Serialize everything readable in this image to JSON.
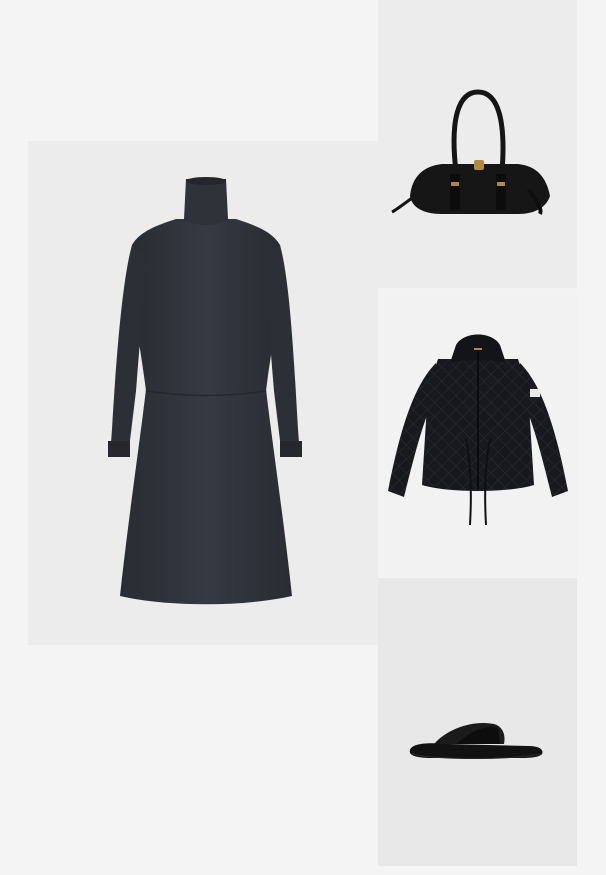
{
  "products": [
    {
      "id": "dress",
      "icon": "turtleneck-knit-dress-image",
      "color": "#2f3139"
    },
    {
      "id": "bag",
      "icon": "black-leather-shoulder-bag-image",
      "color": "#141414"
    },
    {
      "id": "jacket",
      "icon": "quilted-hooded-jacket-image",
      "color": "#16181c"
    },
    {
      "id": "sandal",
      "icon": "crossover-flat-sandal-image",
      "color": "#121212"
    }
  ],
  "colors": {
    "page_background": "#f4f4f4",
    "tile_background": "#ececec",
    "gold_hardware": "#b08a3e"
  }
}
